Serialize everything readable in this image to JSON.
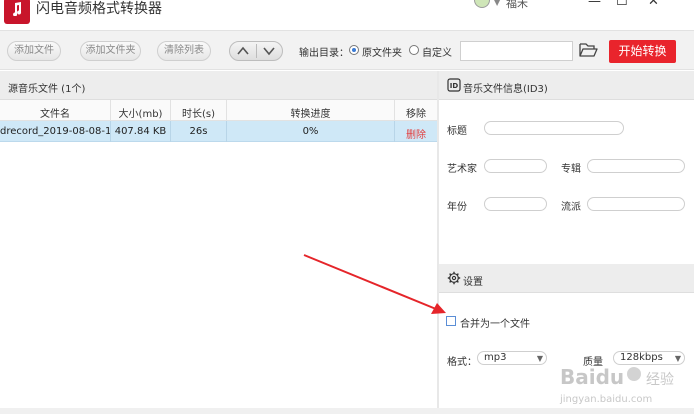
{
  "window": {
    "title": "闪电音频格式转换器",
    "user": {
      "name": "福禾"
    },
    "buttons": {
      "minimize": "—",
      "maximize": "☐",
      "close": "✕"
    }
  },
  "toolbar": {
    "add_file": "添加文件",
    "add_folder": "添加文件夹",
    "clear_list": "清除列表",
    "output_dir_label": "输出目录：",
    "option_original": "原文件夹",
    "option_custom": "自定义",
    "selected_option": "原文件夹",
    "path_value": "",
    "start": "开始转换",
    "accent": "#e9242c"
  },
  "source": {
    "title": "源音乐文件 (1个)",
    "columns": [
      "文件名",
      "大小(mb)",
      "时长(s)",
      "转换进度",
      "移除"
    ],
    "rows": [
      {
        "filename": "drecord_2019-08-08-1...",
        "size": "407.84 KB",
        "duration": "26s",
        "progress": "0%",
        "remove": "删除"
      }
    ],
    "row_highlight": "#cfe8f7"
  },
  "id3": {
    "title": "音乐文件信息(ID3)",
    "fields": {
      "title": {
        "label": "标题",
        "value": ""
      },
      "artist": {
        "label": "艺术家",
        "value": ""
      },
      "album": {
        "label": "专辑",
        "value": ""
      },
      "year": {
        "label": "年份",
        "value": ""
      },
      "genre": {
        "label": "流派",
        "value": ""
      }
    }
  },
  "settings": {
    "title": "设置",
    "merge_label": "合并为一个文件",
    "merge_checked": false,
    "format_label": "格式：",
    "format_value": "mp3",
    "quality_label": "质量",
    "quality_value": "128kbps"
  },
  "watermark": {
    "text1": "Baidu",
    "text2": "经验",
    "url": "jingyan.baidu.com"
  },
  "icons": {
    "logo": "music-note-icon",
    "avatar": "user-avatar-icon",
    "folder": "folder-open-icon",
    "id3": "id-card-icon",
    "settings": "gear-icon"
  }
}
